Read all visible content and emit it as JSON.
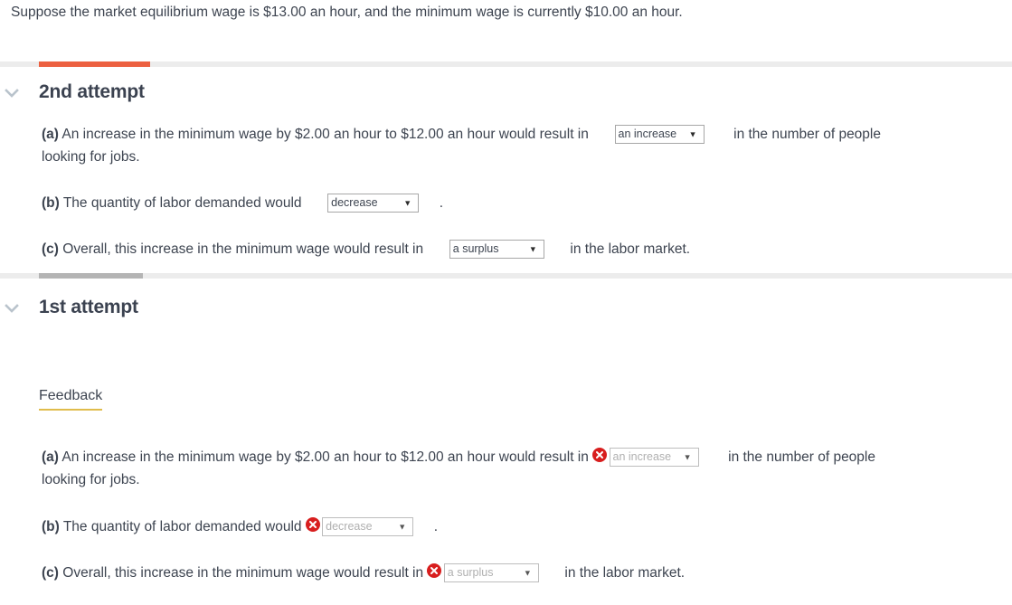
{
  "prompt": {
    "text": "Suppose the market equilibrium wage is $13.00 an hour, and the minimum wage is currently $10.00 an hour."
  },
  "colors": {
    "accent_orange": "#ec6040",
    "bar_gray": "#b4b4b4",
    "bar_track": "#ececec",
    "error_red": "#d81e1e",
    "feedback_underline": "#e0bc4b",
    "text": "#3d4450"
  },
  "icons": {
    "collapse": "chevron-down-icon",
    "error": "error-circle-x-icon",
    "select_caret": "caret-down-icon"
  },
  "attempts": [
    {
      "title": "2nd attempt",
      "bar_color": "#ec6040",
      "graded": false,
      "questions": [
        {
          "label": "(a)",
          "text_before": "An increase in the minimum wage by $2.00 an hour to $12.00 an hour would result in",
          "select_value": "an increase",
          "text_after": "in the number of people",
          "text_second_line": "looking for jobs.",
          "has_error": false
        },
        {
          "label": "(b)",
          "text_before": "The quantity of labor demanded would",
          "select_value": "decrease",
          "text_after": ".",
          "has_error": false
        },
        {
          "label": "(c)",
          "text_before": "Overall, this increase in the minimum wage would result in",
          "select_value": "a surplus",
          "text_after": "in the labor market.",
          "has_error": false
        }
      ]
    },
    {
      "title": "1st attempt",
      "bar_color": "#b4b4b4",
      "graded": true,
      "feedback_label": "Feedback",
      "questions": [
        {
          "label": "(a)",
          "text_before": "An increase in the minimum wage by $2.00 an hour to $12.00 an hour would result in",
          "select_value": "an increase",
          "text_after": "in the number of people",
          "text_second_line": "looking for jobs.",
          "has_error": true
        },
        {
          "label": "(b)",
          "text_before": "The quantity of labor demanded would",
          "select_value": "decrease",
          "text_after": ".",
          "has_error": true
        },
        {
          "label": "(c)",
          "text_before": "Overall, this increase in the minimum wage would result in",
          "select_value": "a surplus",
          "text_after": "in the labor market.",
          "has_error": true
        }
      ]
    }
  ]
}
